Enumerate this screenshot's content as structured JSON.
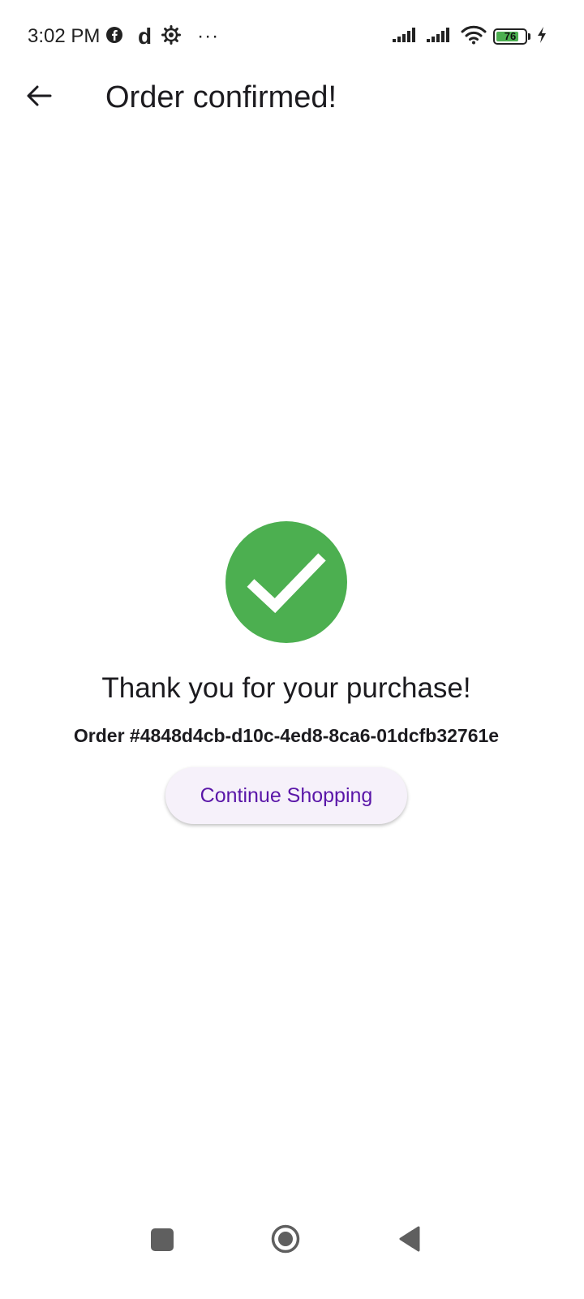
{
  "status_bar": {
    "time": "3:02 PM",
    "left_icons": [
      "facebook-icon",
      "d-app-icon",
      "settings-gear-icon",
      "more-dots-icon"
    ],
    "d_glyph": "d",
    "more_glyph": "···",
    "right_icons": [
      "signal-icon",
      "signal-icon",
      "wifi-icon",
      "battery-icon",
      "charging-icon"
    ],
    "battery_level": "76"
  },
  "app_bar": {
    "back_icon": "arrow-back-icon",
    "title": "Order confirmed!"
  },
  "confirmation": {
    "icon": "check-circle-icon",
    "icon_color": "#4caf50",
    "message": "Thank you for your purchase!",
    "order_label": "Order #4848d4cb-d10c-4ed8-8ca6-01dcfb32761e",
    "continue_label": "Continue Shopping",
    "button_text_color": "#5a16a8",
    "button_bg_color": "#f6f1fa"
  },
  "nav_bar": {
    "items": [
      "recents-icon",
      "home-icon",
      "back-icon"
    ]
  }
}
